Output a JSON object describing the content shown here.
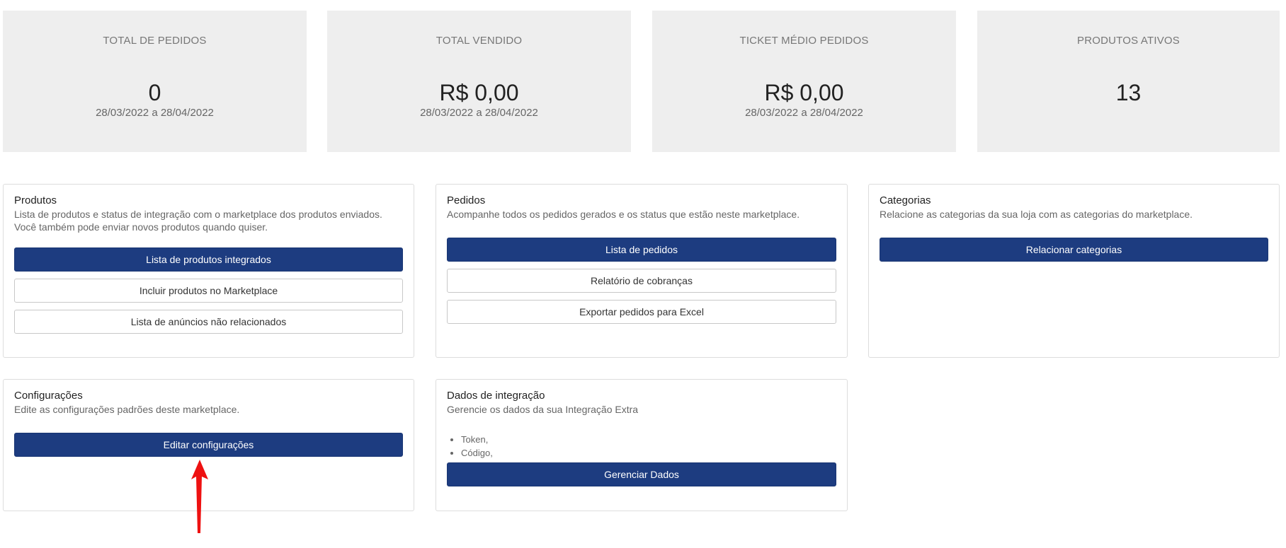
{
  "stats": [
    {
      "label": "TOTAL DE PEDIDOS",
      "value": "0",
      "range": "28/03/2022 a 28/04/2022"
    },
    {
      "label": "TOTAL VENDIDO",
      "value": "R$ 0,00",
      "range": "28/03/2022 a 28/04/2022"
    },
    {
      "label": "TICKET MÉDIO PEDIDOS",
      "value": "R$ 0,00",
      "range": "28/03/2022 a 28/04/2022"
    },
    {
      "label": "PRODUTOS ATIVOS",
      "value": "13",
      "range": ""
    }
  ],
  "produtos": {
    "title": "Produtos",
    "desc_line1": "Lista de produtos e status de integração com o marketplace dos produtos enviados.",
    "desc_line2": "Você também pode enviar novos produtos quando quiser.",
    "btn_list": "Lista de produtos integrados",
    "btn_include": "Incluir produtos no Marketplace",
    "btn_unrelated": "Lista de anúncios não relacionados"
  },
  "pedidos": {
    "title": "Pedidos",
    "desc": "Acompanhe todos os pedidos gerados e os status que estão neste marketplace.",
    "btn_list": "Lista de pedidos",
    "btn_report": "Relatório de cobranças",
    "btn_export": "Exportar pedidos para Excel"
  },
  "categorias": {
    "title": "Categorias",
    "desc": "Relacione as categorias da sua loja com as categorias do marketplace.",
    "btn_relate": "Relacionar categorias"
  },
  "configuracoes": {
    "title": "Configurações",
    "desc": "Edite as configurações padrões deste marketplace.",
    "btn_edit": "Editar configurações"
  },
  "integracao": {
    "title": "Dados de integração",
    "desc": "Gerencie os dados da sua Integração Extra",
    "items": [
      "Token,",
      "Código,"
    ],
    "btn_manage": "Gerenciar Dados"
  },
  "colors": {
    "primary_button": "#1d3c80",
    "stat_background": "#eeeeee",
    "annotation_arrow": "#ee1111"
  },
  "icons": {
    "annotation": "red-arrow-up-icon"
  }
}
